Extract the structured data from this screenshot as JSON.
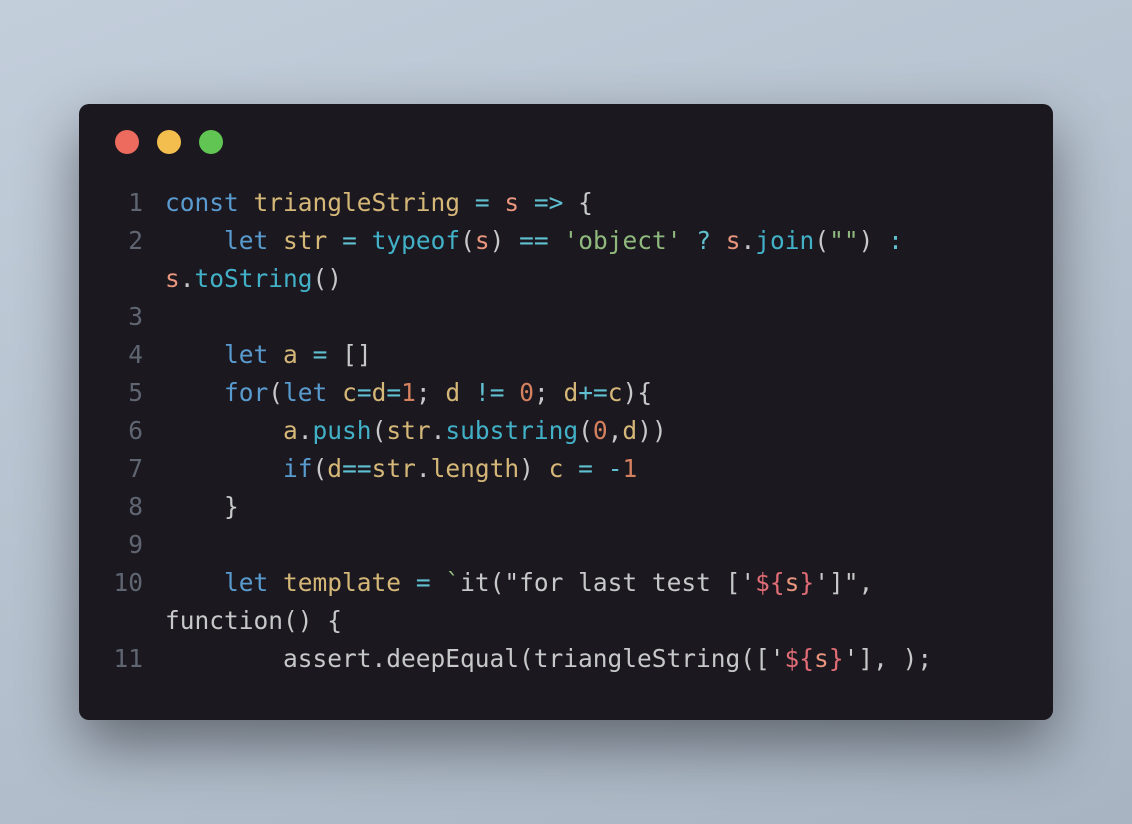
{
  "window": {
    "controls": [
      "close",
      "minimize",
      "zoom"
    ]
  },
  "colors": {
    "bg_window": "#1b181f",
    "bg_page_top": "#c3cedb",
    "bg_page_bottom": "#a8b4c2",
    "dot_red": "#ec6a5e",
    "dot_yellow": "#f4be4f",
    "dot_green": "#61c554",
    "gutter": "#5f6671",
    "text": "#c6c8c9",
    "keyword": "#5a9bcf",
    "ident": "#d5b778",
    "call": "#42b1c7",
    "param": "#e9967e",
    "operator": "#60c0d0",
    "number": "#d5805e",
    "string": "#90b97d",
    "interp": "#e06c75"
  },
  "code": {
    "lines": [
      {
        "n": "1",
        "t": [
          {
            "c": "kw",
            "v": "const"
          },
          {
            "c": "pn",
            "v": " "
          },
          {
            "c": "fn",
            "v": "triangleString"
          },
          {
            "c": "pn",
            "v": " "
          },
          {
            "c": "op",
            "v": "="
          },
          {
            "c": "pn",
            "v": " "
          },
          {
            "c": "par",
            "v": "s"
          },
          {
            "c": "pn",
            "v": " "
          },
          {
            "c": "op",
            "v": "=>"
          },
          {
            "c": "pn",
            "v": " {"
          }
        ]
      },
      {
        "n": "2",
        "t": [
          {
            "c": "pn",
            "v": "    "
          },
          {
            "c": "kw",
            "v": "let"
          },
          {
            "c": "pn",
            "v": " "
          },
          {
            "c": "fn",
            "v": "str"
          },
          {
            "c": "pn",
            "v": " "
          },
          {
            "c": "op",
            "v": "="
          },
          {
            "c": "pn",
            "v": " "
          },
          {
            "c": "typ",
            "v": "typeof"
          },
          {
            "c": "pn",
            "v": "("
          },
          {
            "c": "par",
            "v": "s"
          },
          {
            "c": "pn",
            "v": ") "
          },
          {
            "c": "op",
            "v": "=="
          },
          {
            "c": "pn",
            "v": " "
          },
          {
            "c": "str",
            "v": "'object'"
          },
          {
            "c": "pn",
            "v": " "
          },
          {
            "c": "op",
            "v": "?"
          },
          {
            "c": "pn",
            "v": " "
          },
          {
            "c": "par",
            "v": "s"
          },
          {
            "c": "pn",
            "v": "."
          },
          {
            "c": "fnc",
            "v": "join"
          },
          {
            "c": "pn",
            "v": "("
          },
          {
            "c": "str",
            "v": "\"\""
          },
          {
            "c": "pn",
            "v": ") "
          },
          {
            "c": "op",
            "v": ":"
          },
          {
            "c": "pn",
            "v": " "
          },
          {
            "c": "par",
            "v": "s"
          },
          {
            "c": "pn",
            "v": "."
          },
          {
            "c": "fnc",
            "v": "toString"
          },
          {
            "c": "pn",
            "v": "()"
          }
        ]
      },
      {
        "n": "3",
        "t": [
          {
            "c": "pn",
            "v": ""
          }
        ]
      },
      {
        "n": "4",
        "t": [
          {
            "c": "pn",
            "v": "    "
          },
          {
            "c": "kw",
            "v": "let"
          },
          {
            "c": "pn",
            "v": " "
          },
          {
            "c": "fn",
            "v": "a"
          },
          {
            "c": "pn",
            "v": " "
          },
          {
            "c": "op",
            "v": "="
          },
          {
            "c": "pn",
            "v": " []"
          }
        ]
      },
      {
        "n": "5",
        "t": [
          {
            "c": "pn",
            "v": "    "
          },
          {
            "c": "kw",
            "v": "for"
          },
          {
            "c": "pn",
            "v": "("
          },
          {
            "c": "kw",
            "v": "let"
          },
          {
            "c": "pn",
            "v": " "
          },
          {
            "c": "fn",
            "v": "c"
          },
          {
            "c": "op",
            "v": "="
          },
          {
            "c": "fn",
            "v": "d"
          },
          {
            "c": "op",
            "v": "="
          },
          {
            "c": "num",
            "v": "1"
          },
          {
            "c": "pn",
            "v": "; "
          },
          {
            "c": "fn",
            "v": "d"
          },
          {
            "c": "pn",
            "v": " "
          },
          {
            "c": "op",
            "v": "!="
          },
          {
            "c": "pn",
            "v": " "
          },
          {
            "c": "num",
            "v": "0"
          },
          {
            "c": "pn",
            "v": "; "
          },
          {
            "c": "fn",
            "v": "d"
          },
          {
            "c": "op",
            "v": "+="
          },
          {
            "c": "fn",
            "v": "c"
          },
          {
            "c": "pn",
            "v": "){"
          }
        ]
      },
      {
        "n": "6",
        "t": [
          {
            "c": "pn",
            "v": "        "
          },
          {
            "c": "fn",
            "v": "a"
          },
          {
            "c": "pn",
            "v": "."
          },
          {
            "c": "fnc",
            "v": "push"
          },
          {
            "c": "pn",
            "v": "("
          },
          {
            "c": "fn",
            "v": "str"
          },
          {
            "c": "pn",
            "v": "."
          },
          {
            "c": "fnc",
            "v": "substring"
          },
          {
            "c": "pn",
            "v": "("
          },
          {
            "c": "num",
            "v": "0"
          },
          {
            "c": "pn",
            "v": ","
          },
          {
            "c": "fn",
            "v": "d"
          },
          {
            "c": "pn",
            "v": "))"
          }
        ]
      },
      {
        "n": "7",
        "t": [
          {
            "c": "pn",
            "v": "        "
          },
          {
            "c": "kw",
            "v": "if"
          },
          {
            "c": "pn",
            "v": "("
          },
          {
            "c": "fn",
            "v": "d"
          },
          {
            "c": "op",
            "v": "=="
          },
          {
            "c": "fn",
            "v": "str"
          },
          {
            "c": "pn",
            "v": "."
          },
          {
            "c": "fn",
            "v": "length"
          },
          {
            "c": "pn",
            "v": ") "
          },
          {
            "c": "fn",
            "v": "c"
          },
          {
            "c": "pn",
            "v": " "
          },
          {
            "c": "op",
            "v": "="
          },
          {
            "c": "pn",
            "v": " "
          },
          {
            "c": "op",
            "v": "-"
          },
          {
            "c": "num",
            "v": "1"
          }
        ]
      },
      {
        "n": "8",
        "t": [
          {
            "c": "pn",
            "v": "    }"
          }
        ]
      },
      {
        "n": "9",
        "t": [
          {
            "c": "pn",
            "v": ""
          }
        ]
      },
      {
        "n": "10",
        "t": [
          {
            "c": "pn",
            "v": "    "
          },
          {
            "c": "kw",
            "v": "let"
          },
          {
            "c": "pn",
            "v": " "
          },
          {
            "c": "fn",
            "v": "template"
          },
          {
            "c": "pn",
            "v": " "
          },
          {
            "c": "op",
            "v": "="
          },
          {
            "c": "pn",
            "v": " "
          },
          {
            "c": "str",
            "v": "`"
          },
          {
            "c": "ti",
            "v": "it(\"for last test ['"
          },
          {
            "c": "red",
            "v": "${"
          },
          {
            "c": "par",
            "v": "s"
          },
          {
            "c": "red",
            "v": "}"
          },
          {
            "c": "ti",
            "v": "']\", function() {"
          }
        ]
      },
      {
        "n": "11",
        "t": [
          {
            "c": "pn",
            "v": "        "
          },
          {
            "c": "ti",
            "v": "assert.deepEqual(triangleString(['"
          },
          {
            "c": "red",
            "v": "${"
          },
          {
            "c": "par",
            "v": "s"
          },
          {
            "c": "red",
            "v": "}"
          },
          {
            "c": "ti",
            "v": "'], );"
          }
        ]
      }
    ]
  }
}
